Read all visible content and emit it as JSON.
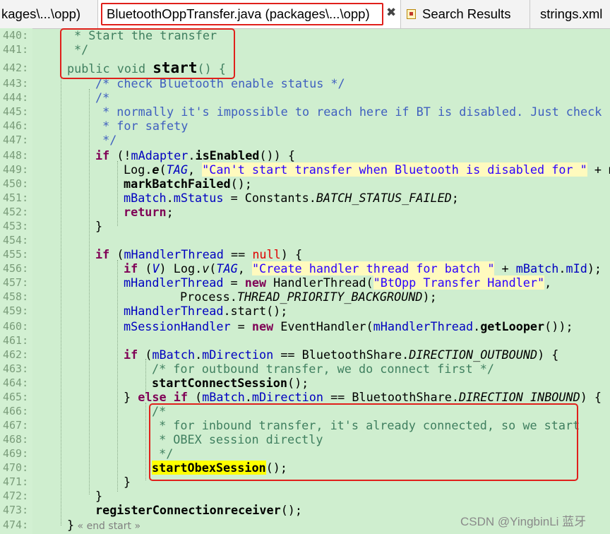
{
  "tabs": [
    {
      "label": "kages\\...\\opp)"
    },
    {
      "label": "BluetoothOppTransfer.java (packages\\...\\opp)",
      "close": "✖"
    },
    {
      "label": "Search Results"
    },
    {
      "label": "strings.xml"
    }
  ],
  "colors": {
    "editor_bg": "#cfeecf",
    "highlight_box": "#e0201b",
    "keyword": "#7f0055",
    "comment": "#3f5fbf",
    "string": "#2a00ff",
    "search_highlight": "#ffff00"
  },
  "icons": {
    "search_results": "search-results-icon",
    "close": "close-icon"
  },
  "code": {
    "l440": {
      "n": "440:",
      "a": "* Start the transfer"
    },
    "l441": {
      "n": "441:",
      "a": "*/"
    },
    "l442": {
      "n": "442:",
      "a": "public",
      "b": " void ",
      "c": "start",
      "d": "() {"
    },
    "l443": {
      "n": "443:",
      "a": "/* check Bluetooth enable status */"
    },
    "l444": {
      "n": "444:",
      "a": "/*"
    },
    "l445": {
      "n": "445:",
      "a": " * normally it's impossible to reach here if BT is disabled. Just check"
    },
    "l446": {
      "n": "446:",
      "a": " * for safety"
    },
    "l447": {
      "n": "447:",
      "a": " */"
    },
    "l448": {
      "n": "448:",
      "a": "if",
      "b": " (!",
      "c": "mAdapter",
      "d": ".",
      "e": "isEnabled",
      "f": "()) {"
    },
    "l449": {
      "n": "449:",
      "a": "Log",
      "b": ".",
      "c": "e",
      "d": "(",
      "e": "TAG",
      "f": ", ",
      "g": "\"Can't start transfer when Bluetooth is disabled for \"",
      "h": " + m"
    },
    "l450": {
      "n": "450:",
      "a": "markBatchFailed",
      "b": "();"
    },
    "l451": {
      "n": "451:",
      "a": "mBatch",
      "b": ".",
      "c": "mStatus",
      "d": " = ",
      "e": "Constants",
      "f": ".",
      "g": "BATCH_STATUS_FAILED",
      "h": ";"
    },
    "l452": {
      "n": "452:",
      "a": "return",
      "b": ";"
    },
    "l453": {
      "n": "453:",
      "a": "}"
    },
    "l454": {
      "n": "454:"
    },
    "l455": {
      "n": "455:",
      "a": "if",
      "b": " (",
      "c": "mHandlerThread",
      "d": " == ",
      "e": "null",
      "f": ") {"
    },
    "l456": {
      "n": "456:",
      "a": "if",
      "b": " (",
      "c": "V",
      "d": ") ",
      "e": "Log",
      "f": ".",
      "g": "v",
      "h": "(",
      "i": "TAG",
      "j": ", ",
      "k": "\"Create handler thread for batch \"",
      "l": " + ",
      "m": "mBatch",
      "o": ".",
      "p": "mId",
      "q": ");"
    },
    "l457": {
      "n": "457:",
      "a": "mHandlerThread",
      "b": " = ",
      "c": "new",
      "d": " HandlerThread(",
      "e": "\"BtOpp Transfer Handler\"",
      "f": ","
    },
    "l458": {
      "n": "458:",
      "a": "Process",
      "b": ".",
      "c": "THREAD_PRIORITY_BACKGROUND",
      "d": ");"
    },
    "l459": {
      "n": "459:",
      "a": "mHandlerThread",
      "b": ".start();"
    },
    "l460": {
      "n": "460:",
      "a": "mSessionHandler",
      "b": " = ",
      "c": "new",
      "d": " EventHandler(",
      "e": "mHandlerThread",
      "f": ".",
      "g": "getLooper",
      "h": "());"
    },
    "l461": {
      "n": "461:"
    },
    "l462": {
      "n": "462:",
      "a": "if",
      "b": " (",
      "c": "mBatch",
      "d": ".",
      "e": "mDirection",
      "f": " == ",
      "g": "BluetoothShare",
      "h": ".",
      "i": "DIRECTION_OUTBOUND",
      "j": ") {"
    },
    "l463": {
      "n": "463:",
      "a": "/* for outbound transfer, we do connect first */"
    },
    "l464": {
      "n": "464:",
      "a": "startConnectSession",
      "b": "();"
    },
    "l465": {
      "n": "465:",
      "a": "} ",
      "b": "else",
      "c": " ",
      "d": "if",
      "e": " (",
      "f": "mBatch",
      "g": ".",
      "h": "mDirection",
      "i": " == ",
      "j": "BluetoothShare",
      "k": ".",
      "l": "DIRECTION_INBOUND",
      "m": ") {"
    },
    "l466": {
      "n": "466:",
      "a": "/*"
    },
    "l467": {
      "n": "467:",
      "a": " * for inbound transfer, it's already connected, so we start"
    },
    "l468": {
      "n": "468:",
      "a": " * OBEX session directly"
    },
    "l469": {
      "n": "469:",
      "a": " */"
    },
    "l470": {
      "n": "470:",
      "a": "startObexSession",
      "b": "();"
    },
    "l471": {
      "n": "471:",
      "a": "}"
    },
    "l472": {
      "n": "472:",
      "a": "}"
    },
    "l473": {
      "n": "473:",
      "a": "registerConnectionreceiver",
      "b": "();"
    },
    "l474": {
      "n": "474:",
      "a": "}",
      "b": " « end start »"
    }
  },
  "watermark": "CSDN @YingbinLi 蓝牙"
}
